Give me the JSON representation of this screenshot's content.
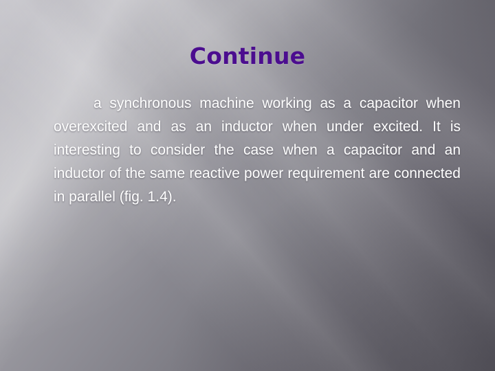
{
  "slide": {
    "title": "Continue",
    "title_color": "#4b0d8f",
    "body_color": "#ffffff",
    "background": {
      "style": "angles",
      "base_light": "#c3c2c8",
      "base_dark": "#5e5c65",
      "description": "gray diagonal gradient with light streaks"
    },
    "body_text": "a synchronous machine working as a capacitor when overexcited and as an inductor when under excited. It is interesting to consider the case when a capacitor and an inductor of the same reactive power requirement are connected in parallel (fig. 1.4).",
    "body_lines": [
      "a synchronous machine working as a",
      "capacitor when overexcited and as an inductor",
      "when under excited. It is interesting to consider",
      "the case when a capacitor and an inductor of",
      "the same reactive power requirement are",
      "connected in parallel (fig. 1.4)."
    ]
  }
}
